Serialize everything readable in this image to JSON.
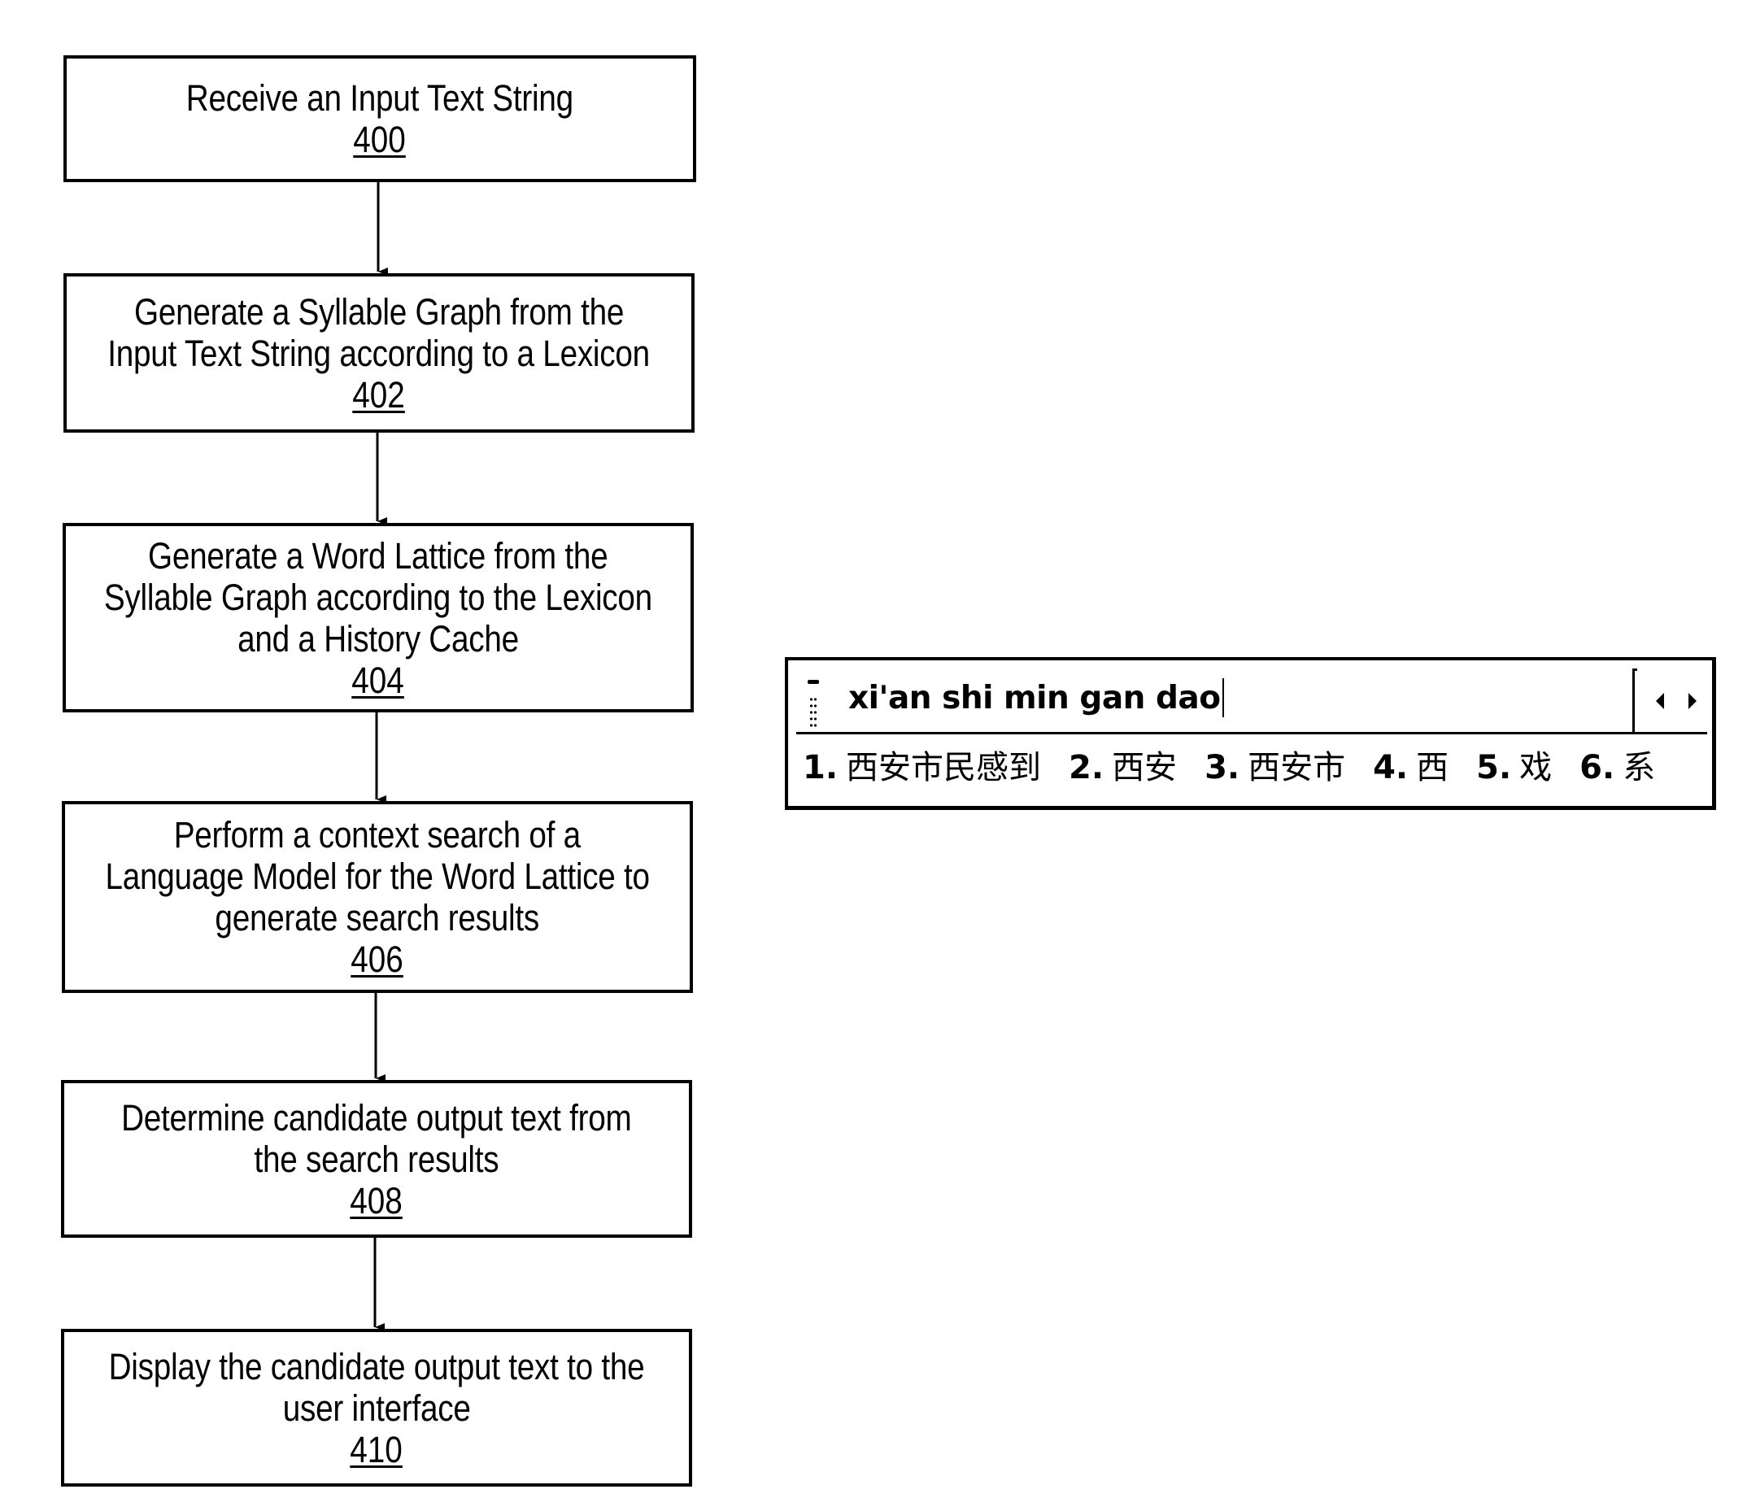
{
  "flowchart": {
    "steps": [
      {
        "lines": [
          "Receive an Input Text String"
        ],
        "ref": "400"
      },
      {
        "lines": [
          "Generate a Syllable Graph from the",
          "Input Text String according to a Lexicon"
        ],
        "ref": "402"
      },
      {
        "lines": [
          "Generate a Word Lattice from the",
          "Syllable Graph according to the Lexicon",
          "and a History Cache"
        ],
        "ref": "404"
      },
      {
        "lines": [
          "Perform a context search of a",
          "Language Model for the Word Lattice to",
          "generate search results"
        ],
        "ref": "406"
      },
      {
        "lines": [
          "Determine candidate output text from",
          "the search results"
        ],
        "ref": "408"
      },
      {
        "lines": [
          "Display the candidate output text to the",
          "user interface"
        ],
        "ref": "410"
      }
    ]
  },
  "ime": {
    "composition": "xi'an shi min gan dao",
    "icons": {
      "grip": "drag-grip-icon",
      "prev": "triangle-left-icon",
      "next": "triangle-right-icon"
    },
    "candidates": [
      {
        "num": "1.",
        "text": "西安市民感到"
      },
      {
        "num": "2.",
        "text": "西安"
      },
      {
        "num": "3.",
        "text": "西安市"
      },
      {
        "num": "4.",
        "text": "西"
      },
      {
        "num": "5.",
        "text": "戏"
      },
      {
        "num": "6.",
        "text": "系"
      }
    ]
  }
}
